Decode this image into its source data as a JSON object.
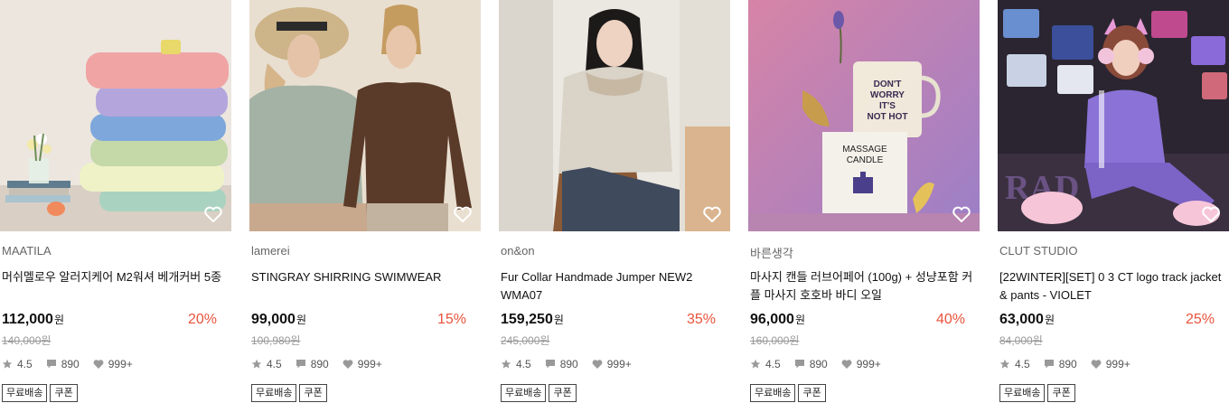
{
  "products": [
    {
      "image": "pastel-pillow-stack-photo",
      "brand": "MAATILA",
      "title": "머쉬멜로우 알러지케어 M2워셔 베개커버 5종",
      "price": "112,000",
      "currency": "원",
      "discount": "20%",
      "original_price": "140,000원",
      "rating": "4.5",
      "reviews": "890",
      "likes": "999+",
      "tags": [
        "무료배송",
        "쿠폰"
      ]
    },
    {
      "image": "two-models-long-sleeve-tops-photo",
      "brand": "lamerei",
      "title": "STINGRAY SHIRRING SWIMWEAR",
      "price": "99,000",
      "currency": "원",
      "discount": "15%",
      "original_price": "100,980원",
      "rating": "4.5",
      "reviews": "890",
      "likes": "999+",
      "tags": [
        "무료배송",
        "쿠폰"
      ]
    },
    {
      "image": "woman-fur-collar-jacket-photo",
      "brand": "on&on",
      "title": "Fur Collar Handmade Jumper NEW2 WMA07",
      "price": "159,250",
      "currency": "원",
      "discount": "35%",
      "original_price": "245,000원",
      "rating": "4.5",
      "reviews": "890",
      "likes": "999+",
      "tags": [
        "무료배송",
        "쿠폰"
      ]
    },
    {
      "image": "massage-candle-photo",
      "brand": "바른생각",
      "title": "마사지 캔들 러브어페어 (100g) + 성냥포함 커플 마사지 호호바 바디 오일",
      "price": "96,000",
      "currency": "원",
      "discount": "40%",
      "original_price": "160,000원",
      "rating": "4.5",
      "reviews": "890",
      "likes": "999+",
      "tags": [
        "무료배송",
        "쿠폰"
      ],
      "image_text": {
        "mug": [
          "DON'T",
          "WORRY",
          "IT'S",
          "NOT HOT"
        ],
        "box": [
          "MASSAGE",
          "CANDLE"
        ]
      }
    },
    {
      "image": "model-violet-tracksuit-photo",
      "brand": "CLUT STUDIO",
      "title": "[22WINTER][SET] 0 3 CT logo track jacket & pants - VIOLET",
      "price": "63,000",
      "currency": "원",
      "discount": "25%",
      "original_price": "84,000원",
      "rating": "4.5",
      "reviews": "890",
      "likes": "999+",
      "tags": [
        "무료배송",
        "쿠폰"
      ]
    }
  ],
  "colors": {
    "discount": "#e8533c",
    "muted": "#999999",
    "brand_text": "#666666"
  }
}
